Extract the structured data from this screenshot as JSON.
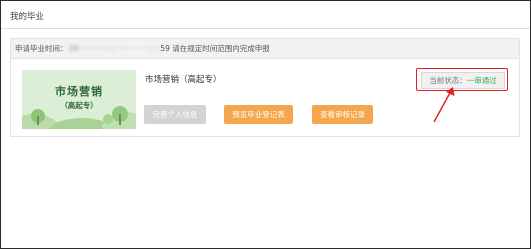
{
  "page": {
    "title": "我的毕业"
  },
  "notice": {
    "prefix": "申请毕业时间：",
    "masked_time_1": "20·· ·· ·· ··:··:··",
    "masked_time_2": "··· ·· ·· ··:··:",
    "time_tail": "59",
    "suffix": "请在规定时间范围内完成申报"
  },
  "program": {
    "card_title": "市场营销",
    "card_subtitle": "（高起专）",
    "name": "市场营销（高起专）"
  },
  "actions": {
    "complete_info": "完善个人信息",
    "pre_register": "预览毕业登记表",
    "view_review": "查看审核记录"
  },
  "status": {
    "label": "当前状态：",
    "value": "一审通过"
  },
  "colors": {
    "accent_orange": "#f3a64c",
    "status_green": "#3aa94b",
    "highlight_red": "#e02020",
    "card_green": "#dcefd6"
  }
}
